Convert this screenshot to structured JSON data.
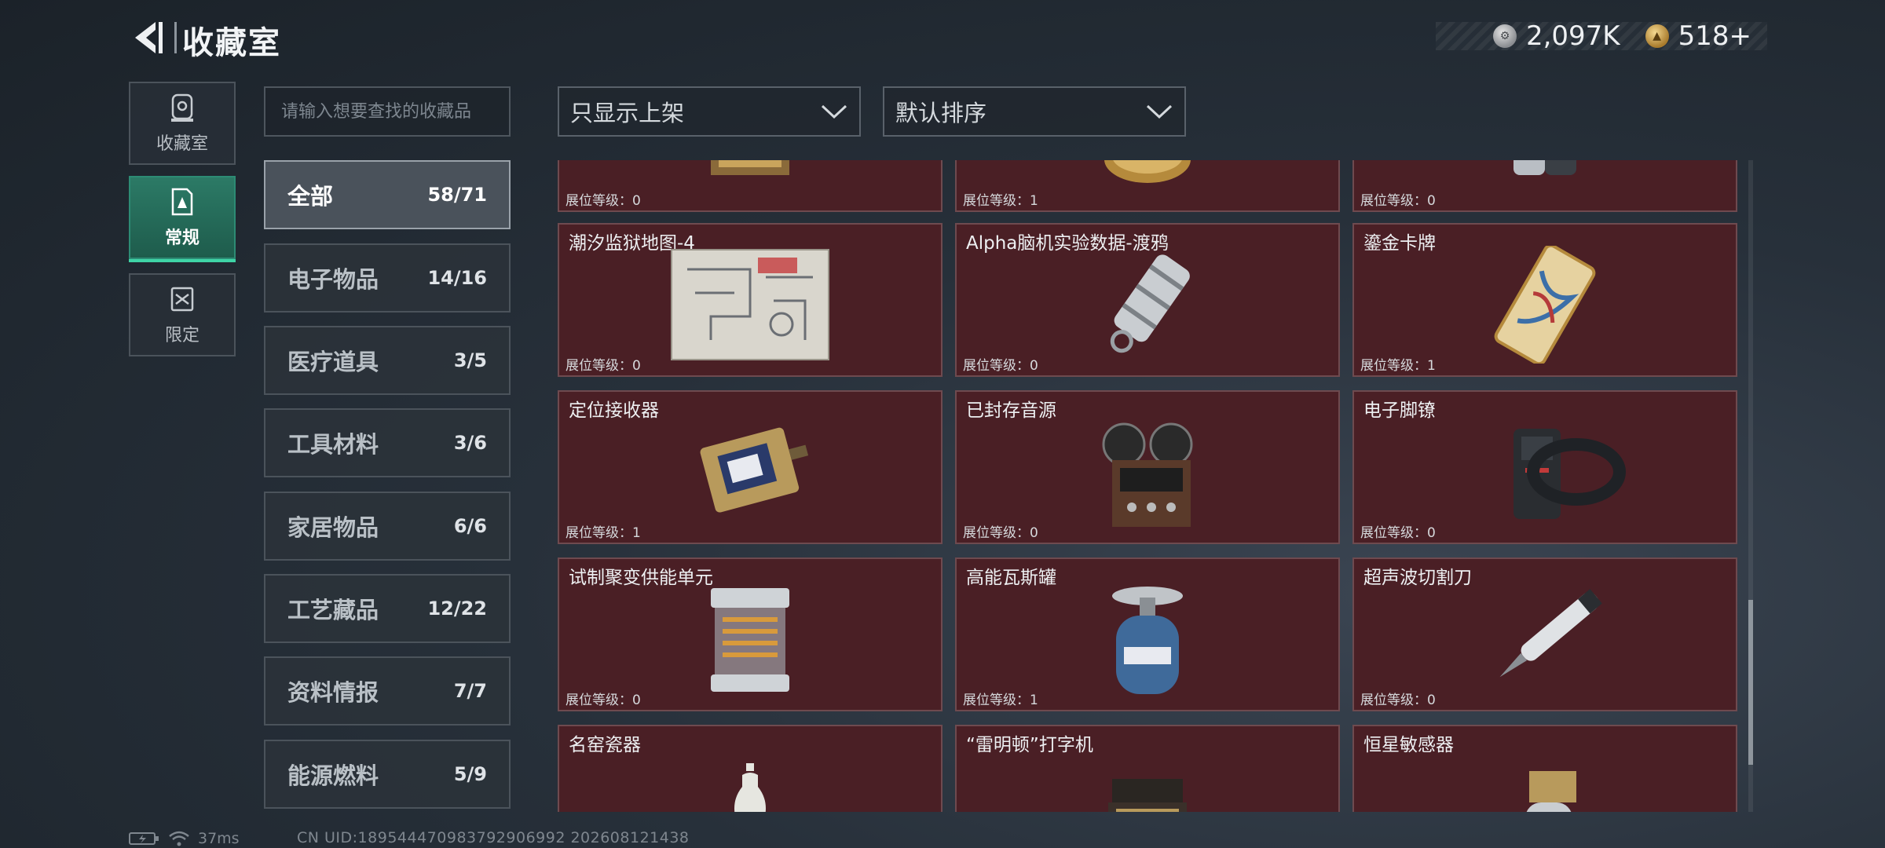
{
  "header": {
    "title": "收藏室"
  },
  "currency": [
    {
      "icon": "silver-coin-icon",
      "value": "2,097K"
    },
    {
      "icon": "gold-coin-icon",
      "value": "518+"
    }
  ],
  "nav": [
    {
      "label": "收藏室",
      "icon": "collection-room-icon",
      "active": false
    },
    {
      "label": "常规",
      "icon": "regular-icon",
      "active": true
    },
    {
      "label": "限定",
      "icon": "limited-icon",
      "active": false
    }
  ],
  "search": {
    "placeholder": "请输入想要查找的收藏品"
  },
  "categories": [
    {
      "name": "全部",
      "count": "58/71",
      "active": true
    },
    {
      "name": "电子物品",
      "count": "14/16"
    },
    {
      "name": "医疗道具",
      "count": "3/5"
    },
    {
      "name": "工具材料",
      "count": "3/6"
    },
    {
      "name": "家居物品",
      "count": "6/6"
    },
    {
      "name": "工艺藏品",
      "count": "12/22"
    },
    {
      "name": "资料情报",
      "count": "7/7"
    },
    {
      "name": "能源燃料",
      "count": "5/9"
    }
  ],
  "filters": {
    "display": "只显示上架",
    "sort": "默认排序"
  },
  "items": [
    {
      "name": "",
      "level": "展位等级：0",
      "icon": "circuit-board-icon"
    },
    {
      "name": "",
      "level": "展位等级：1",
      "icon": "gold-coin-item-icon"
    },
    {
      "name": "",
      "level": "展位等级：0",
      "icon": "device-icon"
    },
    {
      "name": "潮汐监狱地图-4",
      "level": "展位等级：0",
      "icon": "map-icon"
    },
    {
      "name": "Alpha脑机实验数据-渡鸦",
      "level": "展位等级：0",
      "icon": "data-canister-icon"
    },
    {
      "name": "鎏金卡牌",
      "level": "展位等级：1",
      "icon": "gilded-card-icon"
    },
    {
      "name": "定位接收器",
      "level": "展位等级：1",
      "icon": "receiver-icon"
    },
    {
      "name": "已封存音源",
      "level": "展位等级：0",
      "icon": "tape-recorder-icon"
    },
    {
      "name": "电子脚镣",
      "level": "展位等级：0",
      "icon": "ankle-monitor-icon"
    },
    {
      "name": "试制聚变供能单元",
      "level": "展位等级：0",
      "icon": "fusion-cell-icon"
    },
    {
      "name": "高能瓦斯罐",
      "level": "展位等级：1",
      "icon": "gas-canister-icon"
    },
    {
      "name": "超声波切割刀",
      "level": "展位等级：0",
      "icon": "ultrasonic-knife-icon"
    },
    {
      "name": "名窑瓷器",
      "level": "",
      "icon": "porcelain-icon"
    },
    {
      "name": "“雷明顿”打字机",
      "level": "",
      "icon": "typewriter-icon"
    },
    {
      "name": "恒星敏感器",
      "level": "",
      "icon": "star-sensor-icon"
    }
  ],
  "scroll": {
    "position": 0.68
  },
  "status": {
    "ping": "37ms",
    "uid": "CN UID:1895444709837929069​92 202608121438"
  },
  "colors": {
    "card_bg": "#4a1f25",
    "accent": "#3fd4a6",
    "active_nav": "#2c7a66"
  }
}
